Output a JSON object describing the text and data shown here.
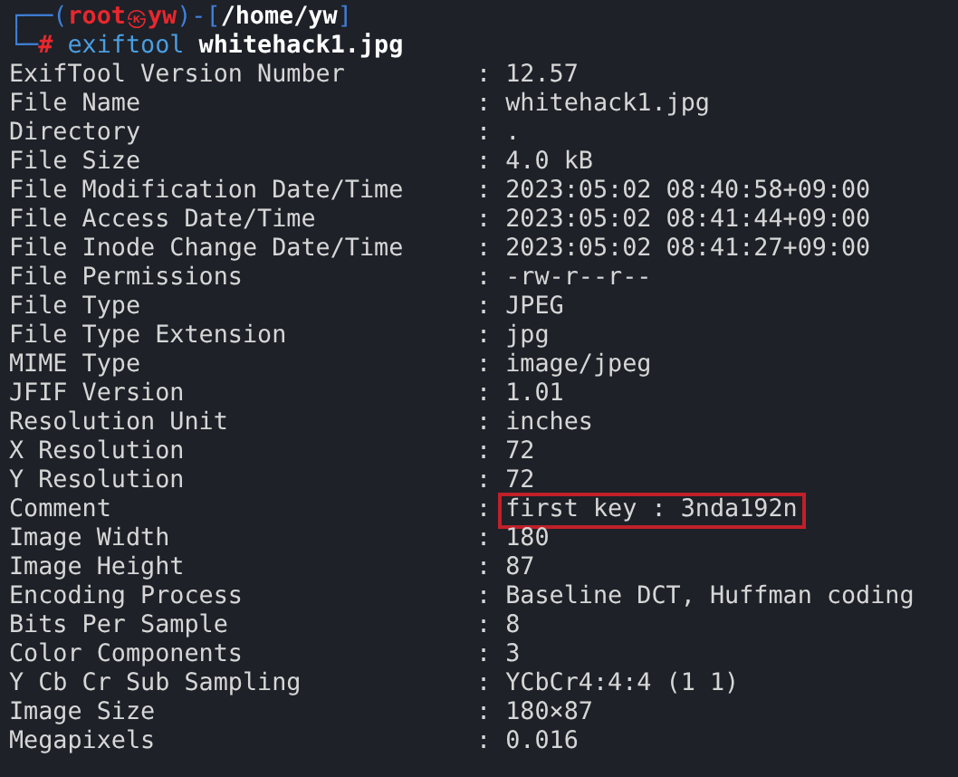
{
  "prompt": {
    "frame_top": "┌──(",
    "user": "root",
    "at_symbol": "㉿",
    "host": "yw",
    "bracket_open": ")-[",
    "path": "/home/yw",
    "bracket_close": "]",
    "frame_bottom": "└─",
    "symbol": "#",
    "command": "exiftool",
    "argument": "whitehack1.jpg"
  },
  "rows": [
    {
      "key": "ExifTool Version Number",
      "separator": ":",
      "value": "12.57",
      "highlighted": false
    },
    {
      "key": "File Name",
      "separator": ":",
      "value": "whitehack1.jpg",
      "highlighted": false
    },
    {
      "key": "Directory",
      "separator": ":",
      "value": ".",
      "highlighted": false
    },
    {
      "key": "File Size",
      "separator": ":",
      "value": "4.0 kB",
      "highlighted": false
    },
    {
      "key": "File Modification Date/Time",
      "separator": ":",
      "value": "2023:05:02 08:40:58+09:00",
      "highlighted": false
    },
    {
      "key": "File Access Date/Time",
      "separator": ":",
      "value": "2023:05:02 08:41:44+09:00",
      "highlighted": false
    },
    {
      "key": "File Inode Change Date/Time",
      "separator": ":",
      "value": "2023:05:02 08:41:27+09:00",
      "highlighted": false
    },
    {
      "key": "File Permissions",
      "separator": ":",
      "value": "-rw-r--r--",
      "highlighted": false
    },
    {
      "key": "File Type",
      "separator": ":",
      "value": "JPEG",
      "highlighted": false
    },
    {
      "key": "File Type Extension",
      "separator": ":",
      "value": "jpg",
      "highlighted": false
    },
    {
      "key": "MIME Type",
      "separator": ":",
      "value": "image/jpeg",
      "highlighted": false
    },
    {
      "key": "JFIF Version",
      "separator": ":",
      "value": "1.01",
      "highlighted": false
    },
    {
      "key": "Resolution Unit",
      "separator": ":",
      "value": "inches",
      "highlighted": false
    },
    {
      "key": "X Resolution",
      "separator": ":",
      "value": "72",
      "highlighted": false
    },
    {
      "key": "Y Resolution",
      "separator": ":",
      "value": "72",
      "highlighted": false
    },
    {
      "key": "Comment",
      "separator": ":",
      "value": "first key : 3nda192n",
      "highlighted": true
    },
    {
      "key": "Image Width",
      "separator": ":",
      "value": "180",
      "highlighted": false
    },
    {
      "key": "Image Height",
      "separator": ":",
      "value": "87",
      "highlighted": false
    },
    {
      "key": "Encoding Process",
      "separator": ":",
      "value": "Baseline DCT, Huffman coding",
      "highlighted": false
    },
    {
      "key": "Bits Per Sample",
      "separator": ":",
      "value": "8",
      "highlighted": false
    },
    {
      "key": "Color Components",
      "separator": ":",
      "value": "3",
      "highlighted": false
    },
    {
      "key": "Y Cb Cr Sub Sampling",
      "separator": ":",
      "value": "YCbCr4:4:4 (1 1)",
      "highlighted": false
    },
    {
      "key": "Image Size",
      "separator": ":",
      "value": "180×87",
      "highlighted": false
    },
    {
      "key": "Megapixels",
      "separator": ":",
      "value": "0.016",
      "highlighted": false
    }
  ]
}
